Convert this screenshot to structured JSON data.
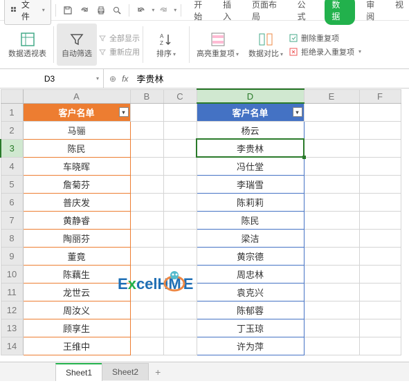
{
  "menu": {
    "file_label": "文件",
    "tabs": [
      "开始",
      "插入",
      "页面布局",
      "公式",
      "数据",
      "审阅",
      "视"
    ],
    "active_tab_index": 4
  },
  "ribbon": {
    "pivot": "数据透视表",
    "autofilter": "自动筛选",
    "show_all": "全部显示",
    "reapply": "重新应用",
    "sort": "排序",
    "highlight_dup": "高亮重复项",
    "data_compare": "数据对比",
    "remove_dup": "删除重复项",
    "reject_dup": "拒绝录入重复项"
  },
  "formula_bar": {
    "cell_ref": "D3",
    "formula": "李贵林"
  },
  "columns": [
    "A",
    "B",
    "C",
    "D",
    "E",
    "F"
  ],
  "active_col": "D",
  "active_row": 3,
  "table_a": {
    "header": "客户名单",
    "rows": [
      "马骊",
      "陈民",
      "车晓晖",
      "詹菊芬",
      "普庆发",
      "黄静睿",
      "陶丽芬",
      "董竟",
      "陈藕生",
      "龙世云",
      "周汝义",
      "顾享生",
      "王维中"
    ]
  },
  "table_d": {
    "header": "客户名单",
    "rows": [
      "杨云",
      "李贵林",
      "冯仕堂",
      "李瑞雪",
      "陈莉莉",
      "陈民",
      "梁洁",
      "黄宗德",
      "周忠林",
      "袁克兴",
      "陈郁蓉",
      "丁玉琼",
      "许为萍"
    ]
  },
  "watermark": {
    "text1": "E",
    "text2": "x",
    "text3": "celH",
    "text4": "ME"
  },
  "sheets": {
    "items": [
      "Sheet1",
      "Sheet2"
    ],
    "active": 0
  }
}
